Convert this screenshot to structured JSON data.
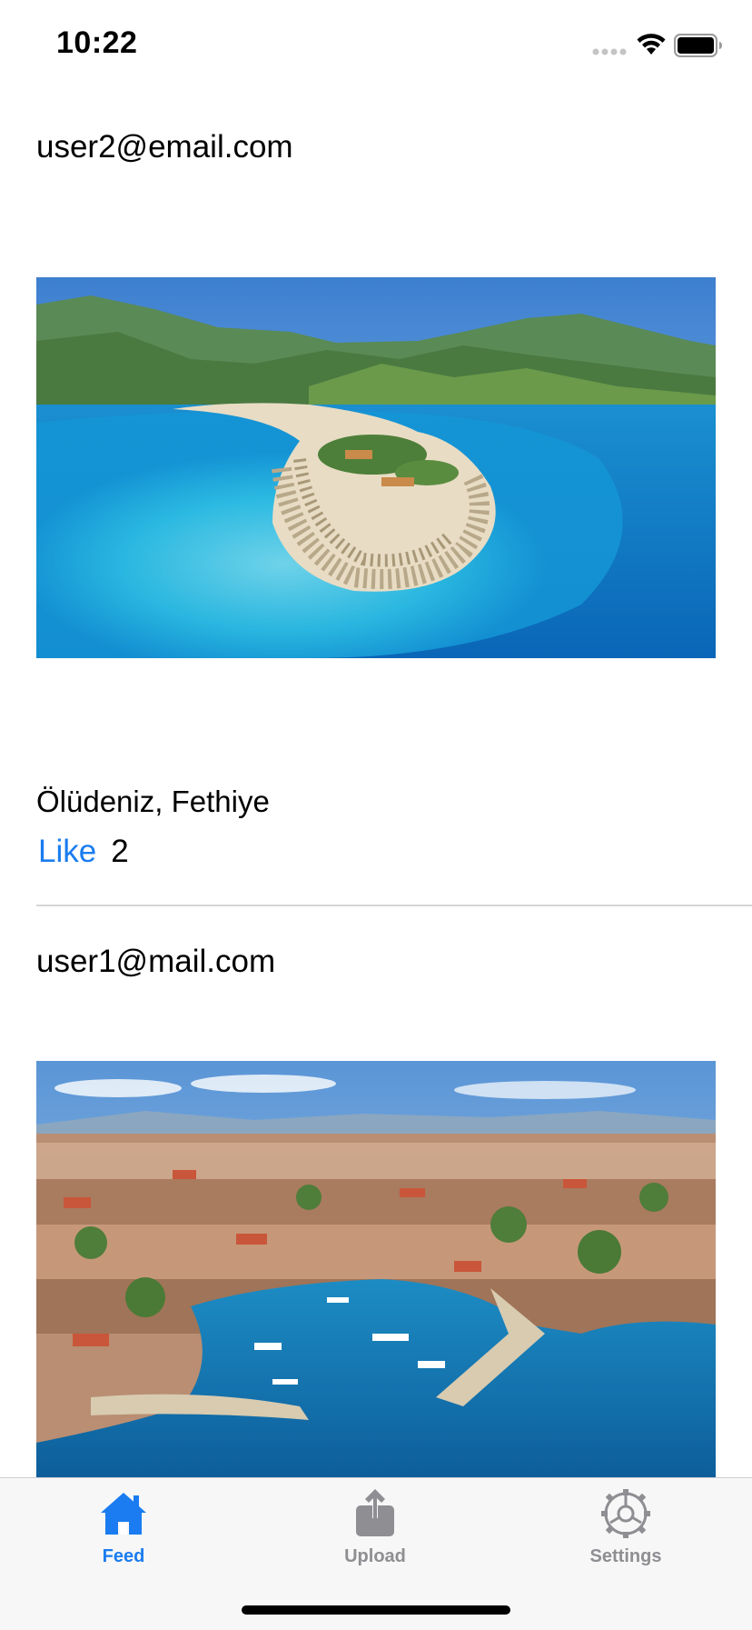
{
  "status_bar": {
    "time": "10:22"
  },
  "feed": {
    "posts": [
      {
        "email": "user2@email.com",
        "image_description_icon": "beach-lagoon-photo",
        "caption": "Ölüdeniz, Fethiye",
        "like_label": "Like",
        "like_count": "2"
      },
      {
        "email": "user1@mail.com",
        "image_description_icon": "harbor-city-photo",
        "caption": "",
        "like_label": "",
        "like_count": ""
      }
    ]
  },
  "tab_bar": {
    "tabs": [
      {
        "label": "Feed",
        "icon": "house-icon",
        "selected": true
      },
      {
        "label": "Upload",
        "icon": "share-upload-icon",
        "selected": false
      },
      {
        "label": "Settings",
        "icon": "gear-icon",
        "selected": false
      }
    ]
  },
  "colors": {
    "accent": "#1a7cf0",
    "inactive_tab": "#8e8e93",
    "separator": "#d6d6d8",
    "tab_bar_bg": "#f7f7f7"
  }
}
